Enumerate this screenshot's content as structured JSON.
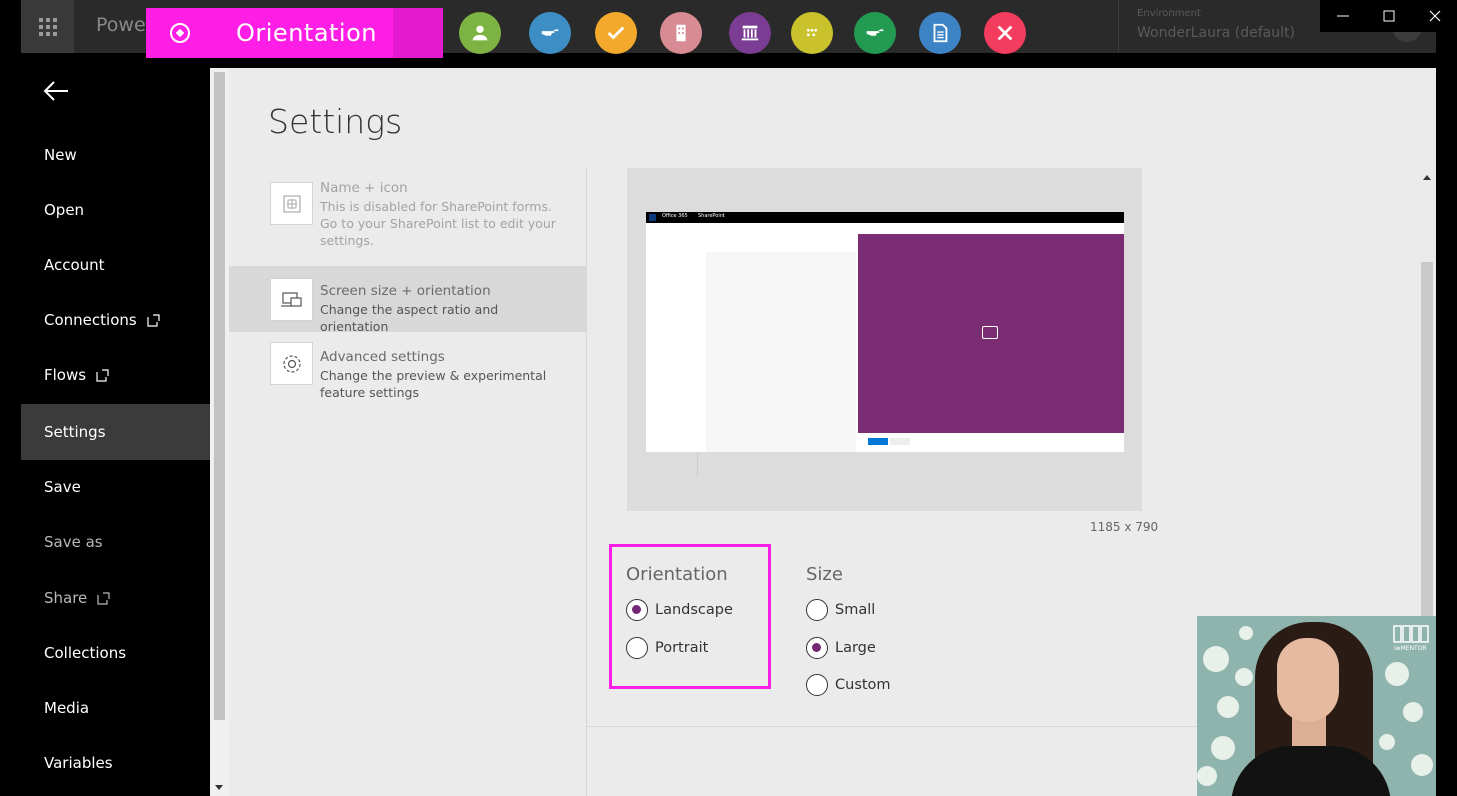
{
  "header": {
    "app_name": "Powe",
    "environment_label": "Environment",
    "environment_name": "WonderLaura (default)"
  },
  "badge": {
    "title": "Orientation",
    "icon": "compass-icon"
  },
  "toolbar_circles": [
    {
      "icon": "person-icon",
      "color": "#7cb342"
    },
    {
      "icon": "hand-pointing-icon",
      "color": "#3d8ec4"
    },
    {
      "icon": "checkmark-icon",
      "color": "#f2a92c"
    },
    {
      "icon": "building-icon",
      "color": "#d98b94"
    },
    {
      "icon": "library-icon",
      "color": "#7a3d93"
    },
    {
      "icon": "dots-grid-icon",
      "color": "#c9c22c"
    },
    {
      "icon": "hand-pointing-icon",
      "color": "#229a52"
    },
    {
      "icon": "document-icon",
      "color": "#3d84c6"
    },
    {
      "icon": "tools-icon",
      "color": "#f33c5e"
    }
  ],
  "nav": {
    "items": [
      {
        "label": "New"
      },
      {
        "label": "Open"
      },
      {
        "label": "Account"
      },
      {
        "label": "Connections"
      },
      {
        "label": "Flows"
      },
      {
        "label": "Settings"
      },
      {
        "label": "Save"
      },
      {
        "label": "Save as"
      },
      {
        "label": "Share"
      },
      {
        "label": "Collections"
      },
      {
        "label": "Media"
      },
      {
        "label": "Variables"
      }
    ]
  },
  "page": {
    "title": "Settings"
  },
  "settings_items": [
    {
      "title": "Name + icon",
      "desc": "This is disabled for SharePoint forms. Go to your SharePoint list to edit your settings."
    },
    {
      "title": "Screen size + orientation",
      "desc": "Change the aspect ratio and orientation"
    },
    {
      "title": "Advanced settings",
      "desc": "Change the preview & experimental feature settings"
    }
  ],
  "preview": {
    "bar_text_1": "Office 365",
    "bar_text_2": "SharePoint",
    "dimensions": "1185 x 790"
  },
  "orientation": {
    "title": "Orientation",
    "options": [
      "Landscape",
      "Portrait"
    ],
    "selected": "Landscape"
  },
  "size": {
    "title": "Size",
    "options": [
      "Small",
      "Large",
      "Custom"
    ],
    "selected": "Large"
  },
  "presenter": {
    "logo_text": "iwMENTOR"
  },
  "colors": {
    "accent_magenta": "#ff1ee6",
    "powerapps_purple": "#742774",
    "preview_purple": "#7b2d73"
  }
}
